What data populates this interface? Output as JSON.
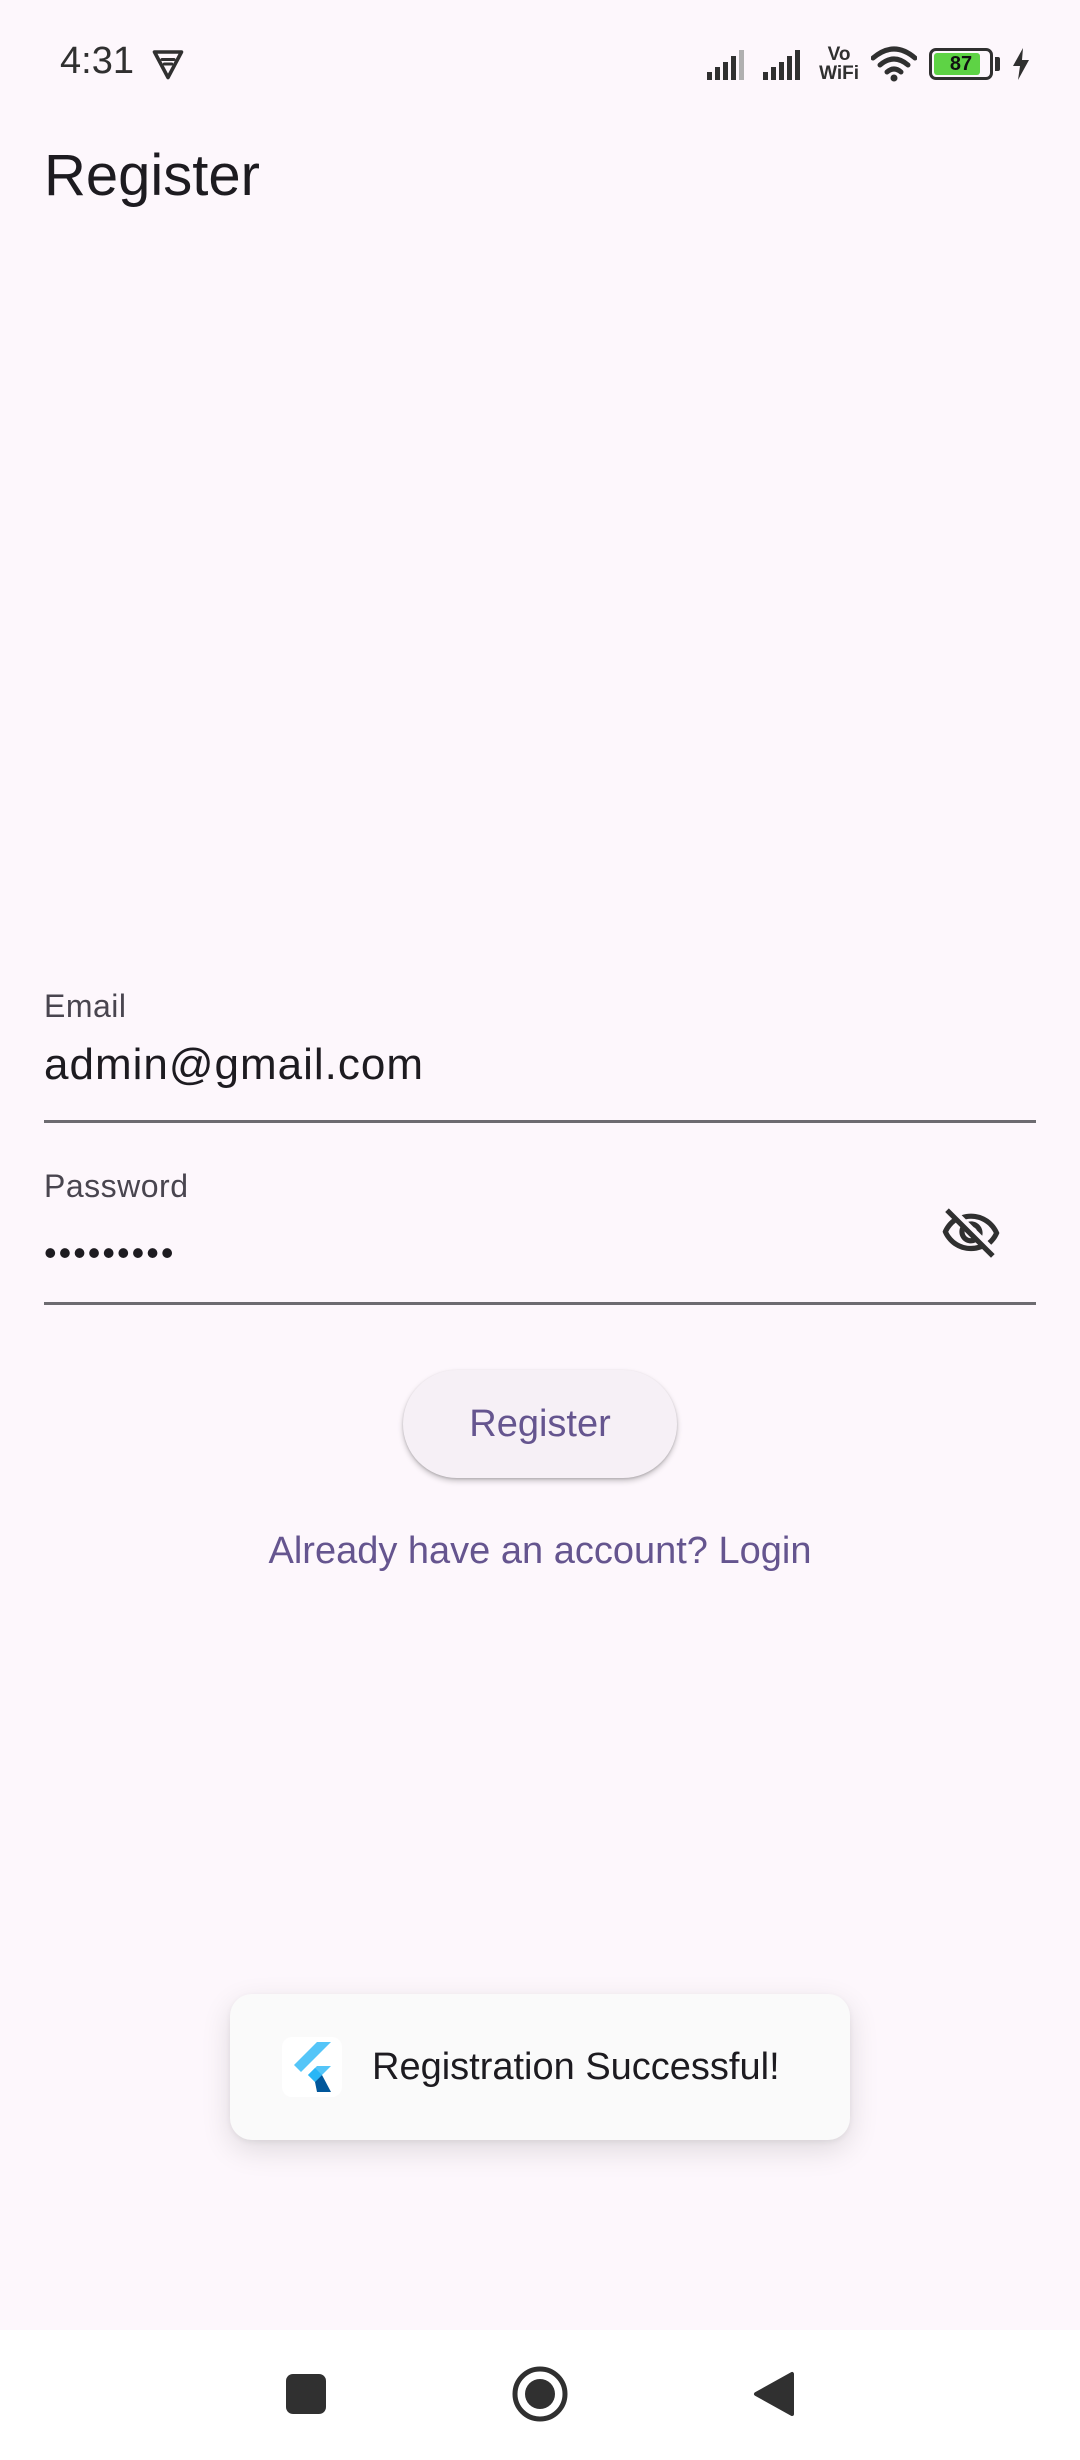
{
  "status_bar": {
    "time": "4:31",
    "battery_level": "87",
    "battery_fraction": 0.87,
    "vowifi_top": "Vo",
    "vowifi_bottom": "WiFi",
    "icons": [
      "vpn-icon",
      "signal-icon",
      "signal-icon",
      "vowifi-icon",
      "wifi-icon",
      "battery-icon",
      "charging-icon"
    ]
  },
  "app_bar": {
    "title": "Register"
  },
  "form": {
    "email": {
      "label": "Email",
      "value": "admin@gmail.com"
    },
    "password": {
      "label": "Password",
      "value_masked": "•••••••••",
      "toggle_icon": "visibility-off-icon"
    },
    "register_button_label": "Register",
    "login_link_text": "Already have an account? Login"
  },
  "toast": {
    "icon": "flutter-logo-icon",
    "message": "Registration Successful!"
  },
  "navigation_bar": {
    "icons": [
      "recents-square-icon",
      "home-circle-icon",
      "back-triangle-icon"
    ]
  },
  "colors": {
    "background": "#fdf7fc",
    "accent": "#65558f",
    "button_surface": "#f6f0f6",
    "battery_fill": "#5ed345"
  }
}
